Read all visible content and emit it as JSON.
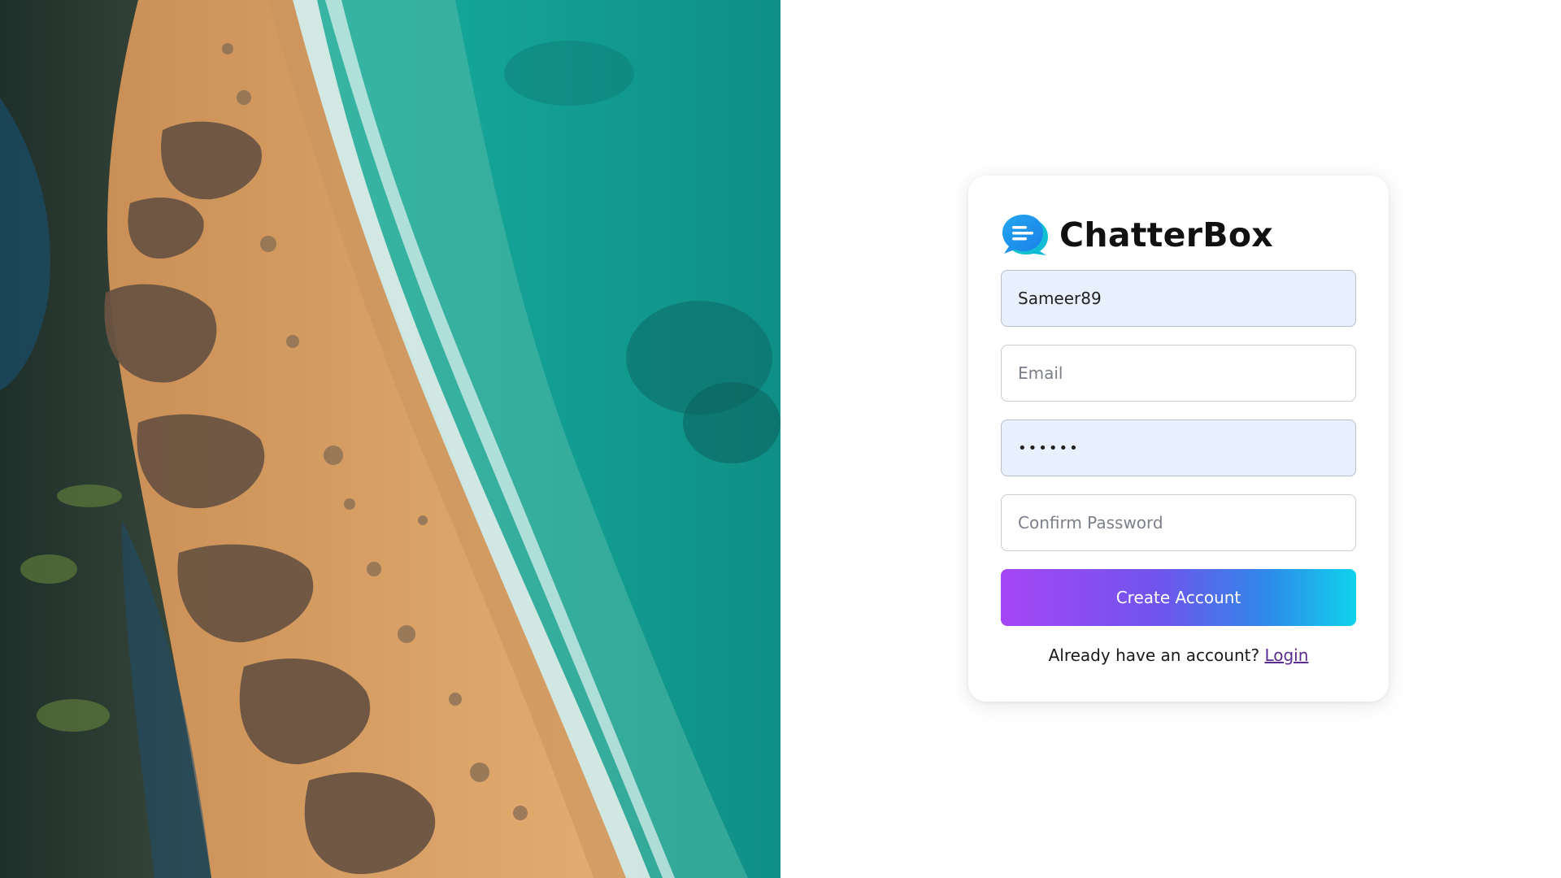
{
  "app": {
    "name": "ChatterBox",
    "logo_icon": "chat-bubbles-icon"
  },
  "hero_image": {
    "description_icon": "beach-photo",
    "colors": {
      "ocean": "#14b3a4",
      "sand": "#d9a46a",
      "rocks": "#6e5a48",
      "forest": "#25362e"
    }
  },
  "form": {
    "username": {
      "value": "Sameer89",
      "placeholder": ""
    },
    "email": {
      "value": "",
      "placeholder": "Email"
    },
    "password": {
      "value": "••••••",
      "placeholder": ""
    },
    "confirm_password": {
      "value": "",
      "placeholder": "Confirm Password"
    },
    "submit_label": "Create Account",
    "login_prompt": "Already have an account?",
    "login_link": "Login"
  },
  "colors": {
    "accent_gradient_start": "#a646f4",
    "accent_gradient_end": "#0fd3ec",
    "autofill_bg": "#e8effd",
    "link": "#5b2d8e"
  }
}
